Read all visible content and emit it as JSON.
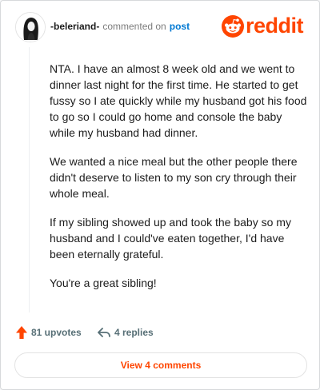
{
  "comment": {
    "username": "-beleriand-",
    "verb": "commented on",
    "target": "post",
    "paragraphs": [
      "NTA. I have an almost 8 week old and we went to dinner last night for the first time. He started to get fussy so I ate quickly while my husband got his food to go so I could go home and console the baby while my husband had dinner.",
      "We wanted a nice meal but the other people there didn't deserve to listen to my son cry through their whole meal.",
      "If my sibling showed up and took the baby so my husband and I could've eaten together, I'd have been eternally grateful.",
      "You're a great sibling!"
    ]
  },
  "brand": {
    "wordmark": "reddit",
    "color": "#ff4500"
  },
  "actions": {
    "upvotes": "81 upvotes",
    "replies": "4 replies",
    "upvote_icon": "upvote-arrow-icon",
    "reply_icon": "reply-arrow-icon",
    "upvote_color": "#ff4500"
  },
  "view_comments": "View 4 comments"
}
